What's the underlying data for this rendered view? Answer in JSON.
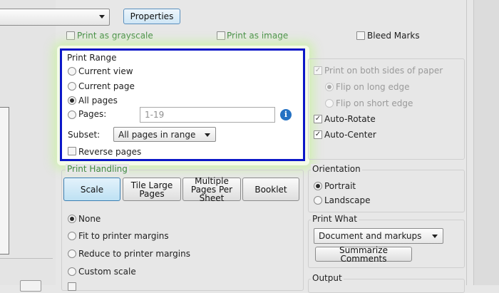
{
  "top": {
    "properties_button": "Properties",
    "print_as_grayscale": "Print as grayscale",
    "print_as_image": "Print as image",
    "bleed_marks": "Bleed Marks"
  },
  "print_range": {
    "title": "Print Range",
    "current_view": "Current view",
    "current_page": "Current page",
    "all_pages": "All pages",
    "pages_label": "Pages:",
    "pages_value": "1-19",
    "subset_label": "Subset:",
    "subset_value": "All pages in range",
    "reverse_pages": "Reverse pages",
    "selected": "all_pages"
  },
  "duplex": {
    "print_both_sides": "Print on both sides of paper",
    "flip_long": "Flip on long edge",
    "flip_short": "Flip on short edge",
    "auto_rotate": "Auto-Rotate",
    "auto_center": "Auto-Center"
  },
  "print_handling": {
    "title": "Print Handling",
    "tabs": [
      "Scale",
      "Tile Large Pages",
      "Multiple Pages Per Sheet",
      "Booklet"
    ],
    "active_tab": "Scale",
    "options": [
      "None",
      "Fit to printer margins",
      "Reduce to printer margins",
      "Custom scale"
    ],
    "selected": "None"
  },
  "orientation": {
    "title": "Orientation",
    "portrait": "Portrait",
    "landscape": "Landscape",
    "selected": "Portrait"
  },
  "print_what": {
    "title": "Print What",
    "value": "Document and markups",
    "summarize_button": "Summarize Comments"
  },
  "output": {
    "title": "Output"
  },
  "colors": {
    "highlight_border": "#0c17c8",
    "glow": "#cdf0aa",
    "active_tab": "#bee1f3",
    "info_icon": "#2471c3"
  },
  "icons": {
    "info": "info-icon",
    "dropdown": "chevron-down-icon"
  }
}
